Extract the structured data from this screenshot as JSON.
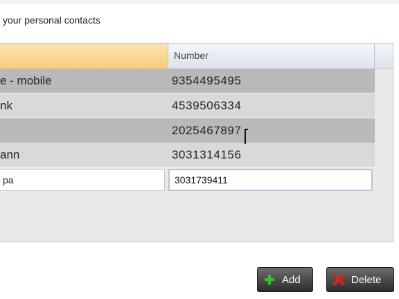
{
  "heading": "your personal contacts",
  "columns": {
    "name_header": "",
    "number_header": "Number"
  },
  "rows": [
    {
      "name": "e - mobile",
      "number": "9354495495"
    },
    {
      "name": "nk",
      "number": "4539506334"
    },
    {
      "name": "",
      "number": "2025467897"
    },
    {
      "name": "ann",
      "number": "3031314156"
    }
  ],
  "edit_row": {
    "name_value": "pa",
    "number_value": "3031739411"
  },
  "buttons": {
    "add_label": "Add",
    "delete_label": "Delete"
  },
  "icons": {
    "add": "plus-icon",
    "delete": "x-icon"
  },
  "colors": {
    "add_icon": "#3fbf2f",
    "delete_icon": "#d9261c",
    "selected_header": "#f6cd7a"
  }
}
